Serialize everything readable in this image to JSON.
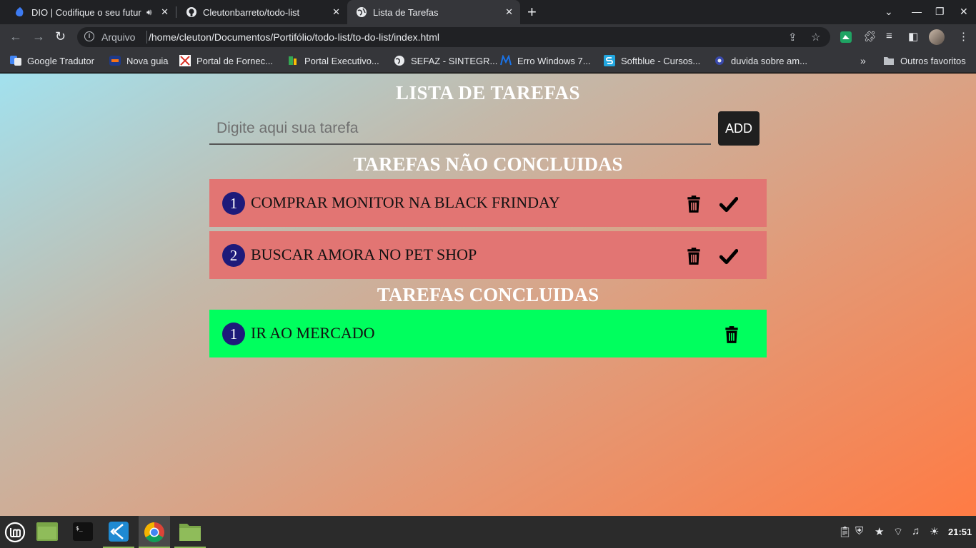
{
  "browser": {
    "tabs": [
      {
        "title": "DIO | Codifique o seu futuro",
        "active": false,
        "audio": true
      },
      {
        "title": "Cleutonbarreto/todo-list",
        "active": false
      },
      {
        "title": "Lista de Tarefas",
        "active": true
      }
    ],
    "address": {
      "security_label": "Arquivo",
      "url": "/home/cleuton/Documentos/Portifólio/todo-list/to-do-list/index.html"
    },
    "bookmarks": [
      "Google Tradutor",
      "Nova guia",
      "Portal de Fornec...",
      "Portal Executivo...",
      "SEFAZ - SINTEGR...",
      "Erro Windows 7...",
      "Softblue - Cursos...",
      "duvida sobre am..."
    ],
    "other_bookmarks": "Outros favoritos"
  },
  "app": {
    "title": "LISTA DE TAREFAS",
    "input_placeholder": "Digite aqui sua tarefa",
    "input_value": "",
    "add_label": "ADD",
    "pending_title": "TAREFAS NÃO CONCLUIDAS",
    "done_title": "TAREFAS CONCLUIDAS",
    "pending_tasks": [
      {
        "number": "1",
        "text": "COMPRAR MONITOR NA BLACK FRINDAY"
      },
      {
        "number": "2",
        "text": "BUSCAR AMORA NO PET SHOP"
      }
    ],
    "done_tasks": [
      {
        "number": "1",
        "text": "IR AO MERCADO"
      }
    ]
  },
  "colors": {
    "pending_task": "#e27573",
    "done_task": "#00ff5e",
    "number_badge": "#1e1a7a",
    "add_button": "#1f1f1f"
  },
  "taskbar": {
    "apps": [
      "mint-menu",
      "files",
      "terminal",
      "vscode",
      "chrome",
      "folder"
    ],
    "clock": "21:51"
  }
}
